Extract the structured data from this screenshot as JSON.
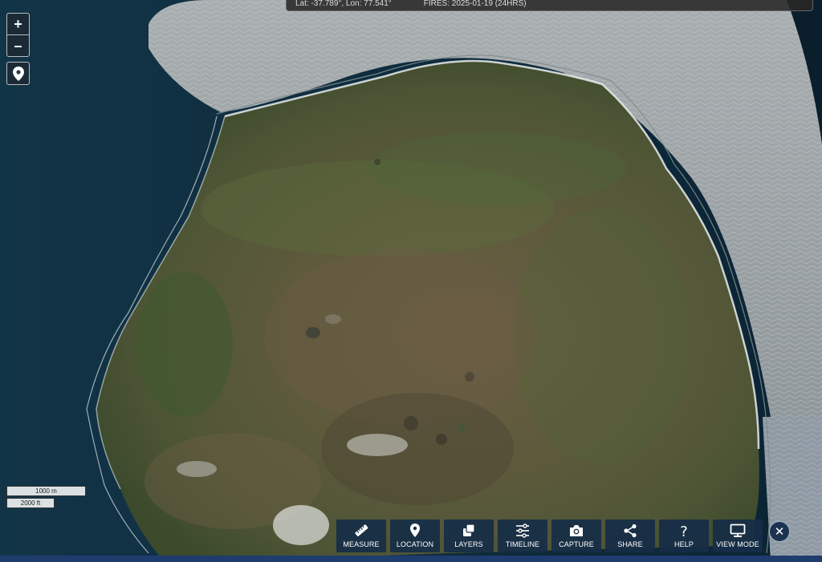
{
  "status": {
    "coords": "Lat: -37.789°, Lon: 77.541°",
    "fires": "FIRES: 2025-01-19 (24HRS)"
  },
  "zoom": {
    "in": "+",
    "out": "–"
  },
  "scale": {
    "metric": "1000 m",
    "imperial": "2000 ft"
  },
  "toolbar": {
    "measure": "MEASURE",
    "location": "LOCATION",
    "layers": "LAYERS",
    "timeline": "TIMELINE",
    "capture": "CAPTURE",
    "share": "SHARE",
    "help": "HELP",
    "view_mode": "VIEW MODE"
  },
  "close": "✕",
  "icons": {
    "zoom_in": "plus-icon",
    "zoom_out": "minus-icon",
    "locate": "map-pin-icon",
    "measure": "ruler-icon",
    "location": "map-pin-icon",
    "layers": "layers-icon",
    "timeline": "sliders-icon",
    "capture": "camera-icon",
    "share": "share-icon",
    "help": "question-icon",
    "view_mode": "monitor-icon",
    "close": "close-icon"
  },
  "colors": {
    "ocean": "#0d2a3c",
    "toolbar_bg": "#162c46",
    "land": "#5e5a3c"
  }
}
